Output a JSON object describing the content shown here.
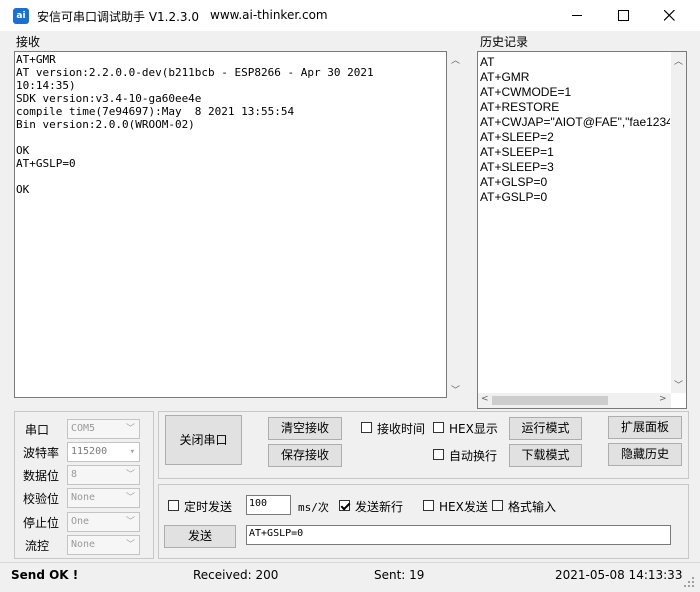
{
  "window": {
    "title": "安信可串口调试助手 V1.2.3.0",
    "url": "www.ai-thinker.com",
    "icon_text": "ai"
  },
  "receive": {
    "label": "接收",
    "lines": [
      "AT+GMR",
      "AT version:2.2.0.0-dev(b211bcb - ESP8266 - Apr 30 2021",
      "10:14:35)",
      "SDK version:v3.4-10-ga60ee4e",
      "compile time(7e94697):May  8 2021 13:55:54",
      "Bin version:2.0.0(WROOM-02)",
      "",
      "OK",
      "AT+GSLP=0",
      "",
      "OK"
    ]
  },
  "history": {
    "label": "历史记录",
    "items": [
      "AT",
      "AT+GMR",
      "AT+CWMODE=1",
      "AT+RESTORE",
      "AT+CWJAP=\"AIOT@FAE\",\"fae1234",
      "AT+SLEEP=2",
      "AT+SLEEP=1",
      "AT+SLEEP=3",
      "AT+GLSP=0",
      "AT+GSLP=0"
    ]
  },
  "serial": {
    "port_label": "串口",
    "port_value": "COM5",
    "baud_label": "波特率",
    "baud_value": "115200",
    "databits_label": "数据位",
    "databits_value": "8",
    "parity_label": "校验位",
    "parity_value": "None",
    "stopbits_label": "停止位",
    "stopbits_value": "One",
    "flow_label": "流控",
    "flow_value": "None"
  },
  "controls": {
    "close_port": "关闭串口",
    "clear_receive": "清空接收",
    "save_receive": "保存接收",
    "receive_time": "接收时间",
    "hex_display": "HEX显示",
    "auto_wrap": "自动换行",
    "run_mode": "运行模式",
    "download_mode": "下载模式",
    "expand_panel": "扩展面板",
    "hide_history": "隐藏历史"
  },
  "send": {
    "timed_send": "定时发送",
    "interval_value": "100",
    "interval_unit": "ms/次",
    "send_newline": "发送新行",
    "hex_send": "HEX发送",
    "format_input": "格式输入",
    "send_button": "发送",
    "send_text": "AT+GSLP=0"
  },
  "status": {
    "state": "Send OK !",
    "received": "Received: 200",
    "sent": "Sent: 19",
    "datetime": "2021-05-08 14:13:33"
  }
}
